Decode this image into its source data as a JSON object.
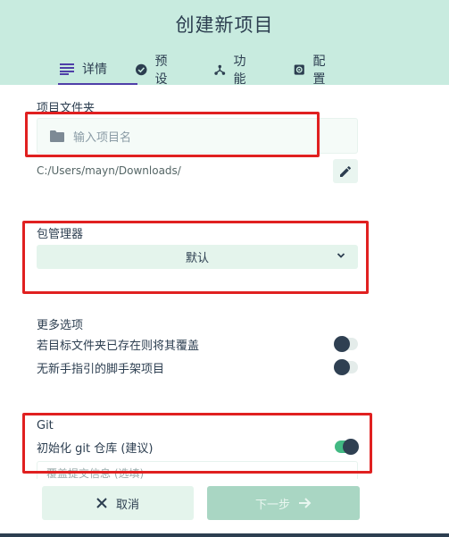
{
  "header": {
    "title": "创建新项目",
    "tabs": [
      {
        "label": "详情",
        "icon": "list-icon",
        "active": true
      },
      {
        "label": "预设",
        "icon": "check-circle-icon",
        "active": false
      },
      {
        "label": "功能",
        "icon": "fork-icon",
        "active": false
      },
      {
        "label": "配置",
        "icon": "gear-icon",
        "active": false
      }
    ]
  },
  "project_folder": {
    "label": "项目文件夹",
    "placeholder": "输入项目名",
    "path": "C:/Users/mayn/Downloads/"
  },
  "package_manager": {
    "label": "包管理器",
    "selected": "默认"
  },
  "more_options": {
    "label": "更多选项",
    "items": [
      {
        "label": "若目标文件夹已存在则将其覆盖",
        "enabled": false
      },
      {
        "label": "无新手指引的脚手架项目",
        "enabled": false
      }
    ]
  },
  "git": {
    "label": "Git",
    "init_label": "初始化 git 仓库 (建议)",
    "init_enabled": true,
    "commit_placeholder": "覆盖提交信息 (选填)"
  },
  "footer": {
    "cancel_label": "取消",
    "next_label": "下一步"
  },
  "colors": {
    "header_bg": "#c8ebdf",
    "accent": "#42b983",
    "tab_indicator": "#4f3fa8",
    "highlight_box": "#e02020"
  }
}
